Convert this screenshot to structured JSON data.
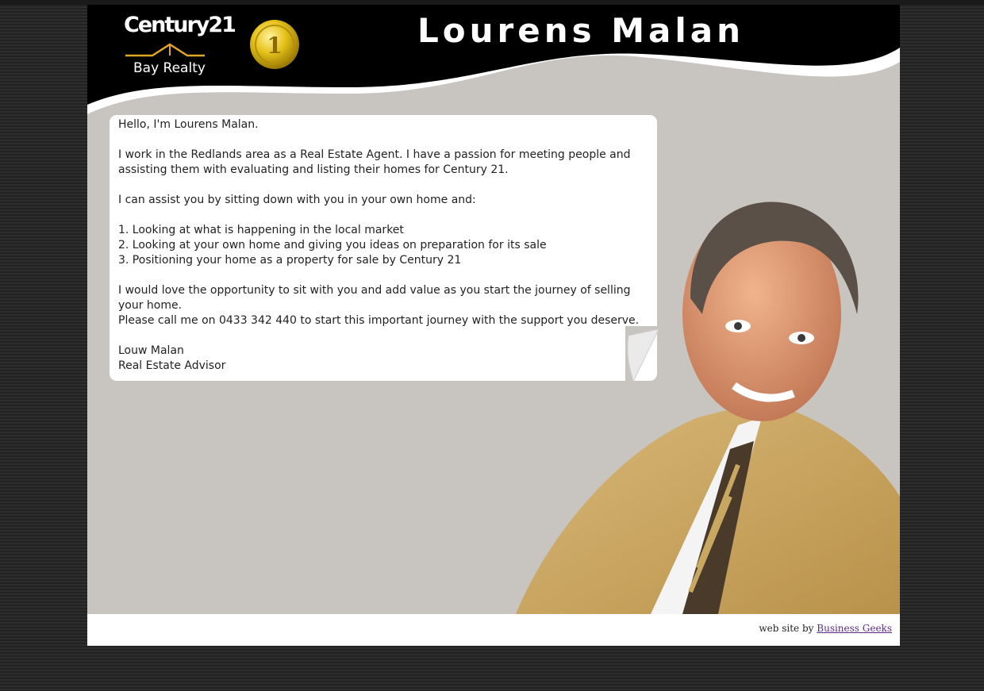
{
  "header": {
    "logo_brand": "Century 21",
    "logo_word": "Century21",
    "logo_subtitle": "Bay Realty",
    "medal_number": "1",
    "title": "Lourens Malan"
  },
  "bio": {
    "lines": [
      "Hello, I'm Lourens Malan.",
      "",
      "I work in the Redlands area as a Real Estate Agent. I have a passion for meeting people and",
      "assisting them with evaluating and listing their homes for Century 21.",
      "",
      "I can assist you by sitting down with you in your own home and:",
      "",
      "1. Looking at what is happening in the local market",
      "2. Looking at your own home and giving you ideas on preparation for its sale",
      "3. Positioning your home as a property for sale by Century 21",
      "",
      "I would love the opportunity to sit with you and add value as you start the journey of selling",
      "your home.",
      "Please call me on 0433 342 440 to start this important journey with the support you deserve.",
      "",
      "Louw Malan",
      "Real Estate Advisor"
    ]
  },
  "footer": {
    "credit_prefix": "web site by",
    "credit_link": "Business Geeks"
  },
  "colors": {
    "header_bg": "#000000",
    "page_bg": "#c8c4bf",
    "logo_gold": "#e0a524",
    "link": "#5b2a8a"
  }
}
